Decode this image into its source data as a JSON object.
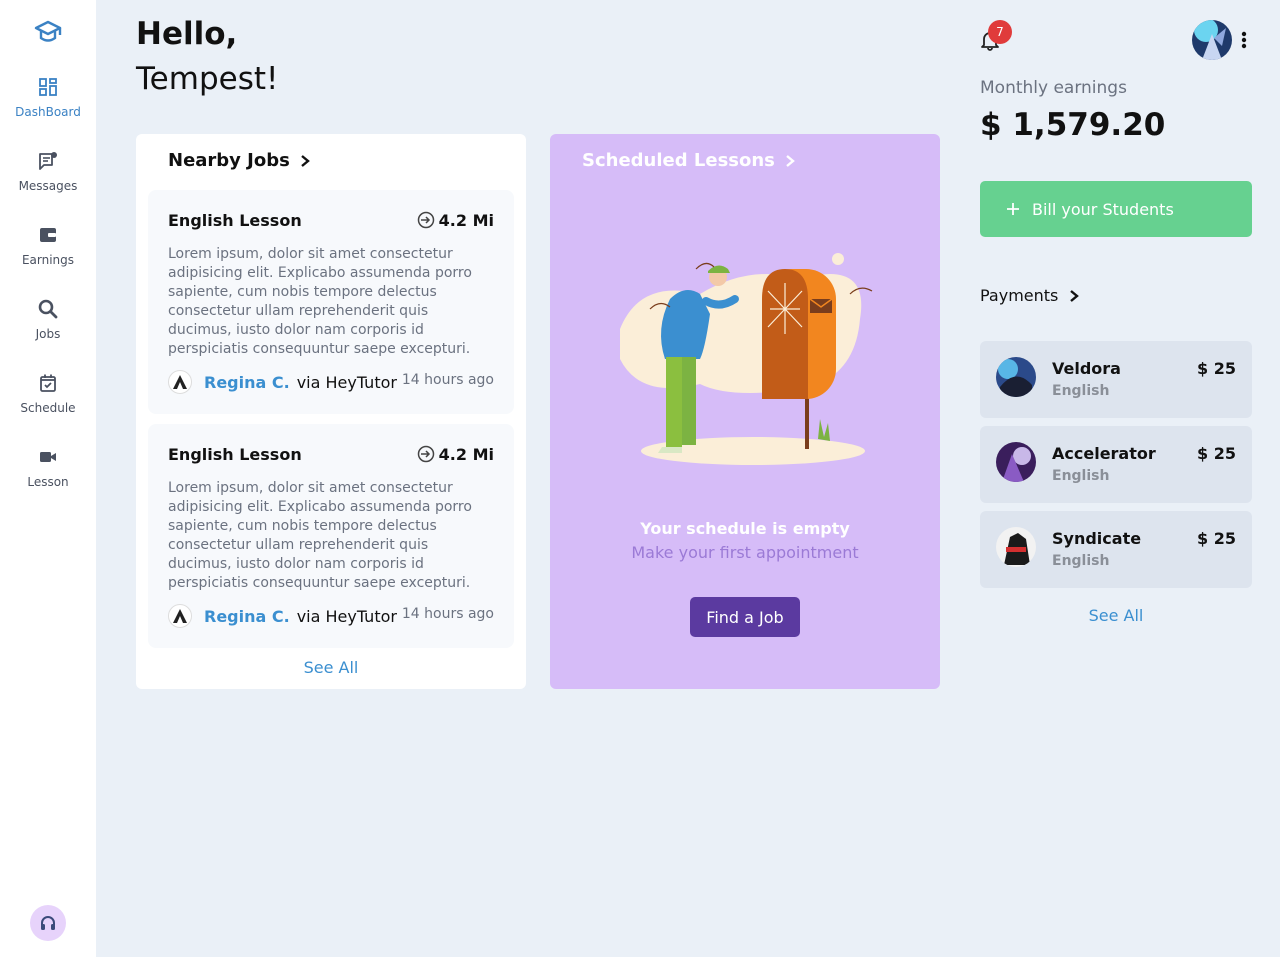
{
  "sidebar": {
    "items": [
      {
        "label": "DashBoard",
        "icon": "dashboard-icon"
      },
      {
        "label": "Messages",
        "icon": "messages-icon"
      },
      {
        "label": "Earnings",
        "icon": "wallet-icon"
      },
      {
        "label": "Jobs",
        "icon": "search-icon"
      },
      {
        "label": "Schedule",
        "icon": "calendar-icon"
      },
      {
        "label": "Lesson",
        "icon": "video-icon"
      }
    ],
    "active": "DashBoard"
  },
  "greeting": {
    "hello": "Hello,",
    "name": "Tempest!"
  },
  "nearby_jobs": {
    "title": "Nearby Jobs",
    "jobs": [
      {
        "title": "English Lesson",
        "distance": "4.2 Mi",
        "description": "Lorem ipsum, dolor sit amet consectetur adipisicing elit. Explicabo assumenda porro sapiente, cum nobis tempore delectus consectetur ullam reprehenderit quis ducimus, iusto dolor nam corporis id perspiciatis consequuntur saepe excepturi.",
        "person": "Regina C.",
        "via": "via HeyTutor",
        "time": "14 hours ago"
      },
      {
        "title": "English Lesson",
        "distance": "4.2 Mi",
        "description": "Lorem ipsum, dolor sit amet consectetur adipisicing elit. Explicabo assumenda porro sapiente, cum nobis tempore delectus consectetur ullam reprehenderit quis ducimus, iusto dolor nam corporis id perspiciatis consequuntur saepe excepturi.",
        "person": "Regina C.",
        "via": "via HeyTutor",
        "time": "14 hours ago"
      }
    ],
    "see_all": "See All"
  },
  "scheduled_lessons": {
    "title": "Scheduled Lessons",
    "empty_title": "Your schedule is empty",
    "empty_sub": "Make your first appointment",
    "button": "Find a Job"
  },
  "header": {
    "notification_count": "7"
  },
  "earnings": {
    "label": "Monthly earnings",
    "value": "$ 1,579.20"
  },
  "bill_button": "Bill your Students",
  "payments": {
    "title": "Payments",
    "items": [
      {
        "name": "Veldora",
        "subject": "English",
        "amount": "$ 25"
      },
      {
        "name": "Accelerator",
        "subject": "English",
        "amount": "$ 25"
      },
      {
        "name": "Syndicate",
        "subject": "English",
        "amount": "$ 25"
      }
    ],
    "see_all": "See All"
  },
  "colors": {
    "accent_blue": "#3b8fd0",
    "lessons_bg": "#d6bcf8",
    "bill_green": "#66d190",
    "find_button": "#5b3aa0",
    "badge_red": "#e03b3b"
  }
}
